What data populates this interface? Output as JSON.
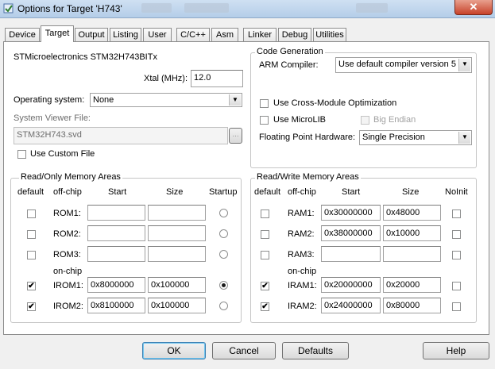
{
  "window": {
    "title": "Options for Target 'H743'"
  },
  "tabs": [
    "Device",
    "Target",
    "Output",
    "Listing",
    "User",
    "C/C++",
    "Asm",
    "Linker",
    "Debug",
    "Utilities"
  ],
  "device": {
    "name": "STMicroelectronics STM32H743BITx"
  },
  "xtal": {
    "label": "Xtal (MHz):",
    "value": "12.0"
  },
  "os": {
    "label": "Operating system:",
    "value": "None"
  },
  "svf": {
    "label": "System Viewer File:",
    "value": "STM32H743.svd",
    "browse": "...",
    "custom_label": "Use Custom File"
  },
  "codegen": {
    "title": "Code Generation",
    "compiler_label": "ARM Compiler:",
    "compiler_value": "Use default compiler version 5",
    "cross_module": "Use Cross-Module Optimization",
    "microlib": "Use MicroLIB",
    "big_endian": "Big Endian",
    "fph_label": "Floating Point Hardware:",
    "fph_value": "Single Precision"
  },
  "rom": {
    "title": "Read/Only Memory Areas",
    "headers": {
      "default": "default",
      "offchip": "off-chip",
      "start": "Start",
      "size": "Size",
      "startup": "Startup"
    },
    "onchip": "on-chip",
    "rows": [
      {
        "name": "ROM1:",
        "start": "",
        "size": "",
        "checked": false,
        "startup": false
      },
      {
        "name": "ROM2:",
        "start": "",
        "size": "",
        "checked": false,
        "startup": false
      },
      {
        "name": "ROM3:",
        "start": "",
        "size": "",
        "checked": false,
        "startup": false
      },
      {
        "name": "IROM1:",
        "start": "0x8000000",
        "size": "0x100000",
        "checked": true,
        "startup": true
      },
      {
        "name": "IROM2:",
        "start": "0x8100000",
        "size": "0x100000",
        "checked": true,
        "startup": false
      }
    ]
  },
  "ram": {
    "title": "Read/Write Memory Areas",
    "headers": {
      "default": "default",
      "offchip": "off-chip",
      "start": "Start",
      "size": "Size",
      "noinit": "NoInit"
    },
    "onchip": "on-chip",
    "rows": [
      {
        "name": "RAM1:",
        "start": "0x30000000",
        "size": "0x48000",
        "checked": false,
        "noinit": false
      },
      {
        "name": "RAM2:",
        "start": "0x38000000",
        "size": "0x10000",
        "checked": false,
        "noinit": false
      },
      {
        "name": "RAM3:",
        "start": "",
        "size": "",
        "checked": false,
        "noinit": false
      },
      {
        "name": "IRAM1:",
        "start": "0x20000000",
        "size": "0x20000",
        "checked": true,
        "noinit": false
      },
      {
        "name": "IRAM2:",
        "start": "0x24000000",
        "size": "0x80000",
        "checked": true,
        "noinit": false
      }
    ]
  },
  "buttons": {
    "ok": "OK",
    "cancel": "Cancel",
    "defaults": "Defaults",
    "help": "Help"
  },
  "check_glyph": "✔"
}
